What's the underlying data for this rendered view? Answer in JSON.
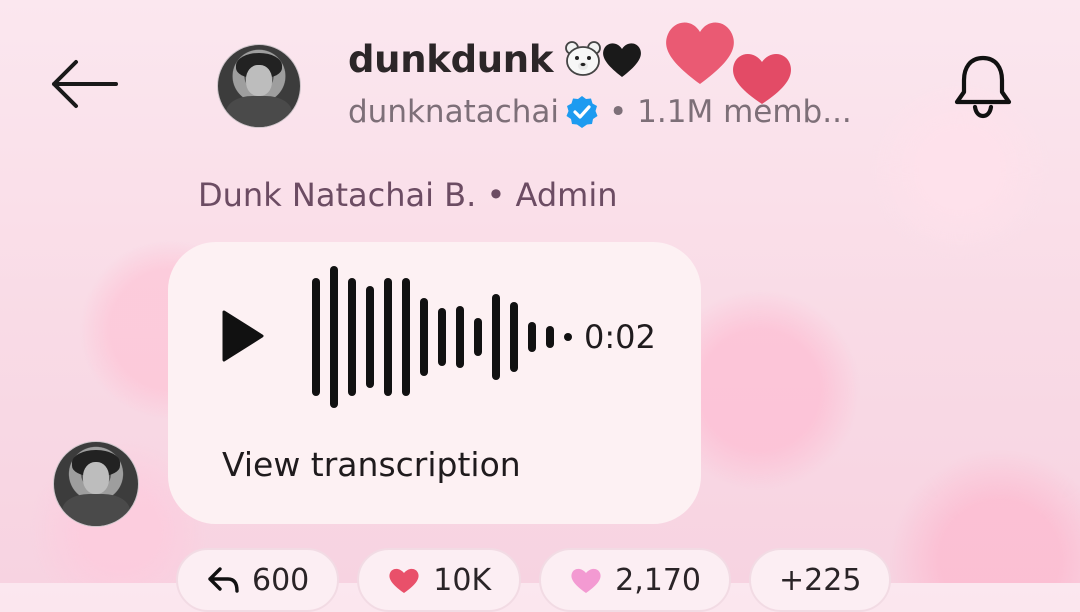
{
  "header": {
    "back_icon": "arrow-left-icon",
    "channel_name": "dunkdunk",
    "name_emojis": [
      "polar-bear-face-emoji",
      "black-heart-emoji"
    ],
    "handle": "dunknatachai",
    "verified_icon": "verified-badge-icon",
    "members_text": "• 1.1M memb...",
    "notification_icon": "bell-icon"
  },
  "message": {
    "sender_line": "Dunk Natachai B. • Admin",
    "voice": {
      "play_icon": "play-icon",
      "duration": "0:02",
      "transcription_label": "View transcription"
    }
  },
  "reactions": [
    {
      "icon": "reply-arrow-icon",
      "count": "600"
    },
    {
      "icon": "red-heart-icon",
      "count": "10K"
    },
    {
      "icon": "sparkling-heart-icon",
      "count": "2,170"
    },
    {
      "icon": "",
      "count": "+225"
    }
  ],
  "colors": {
    "background": "#f9dbe6",
    "bubble": "#fdf1f3",
    "verified": "#1d9bf0",
    "accent_heart": "#e9506a"
  }
}
